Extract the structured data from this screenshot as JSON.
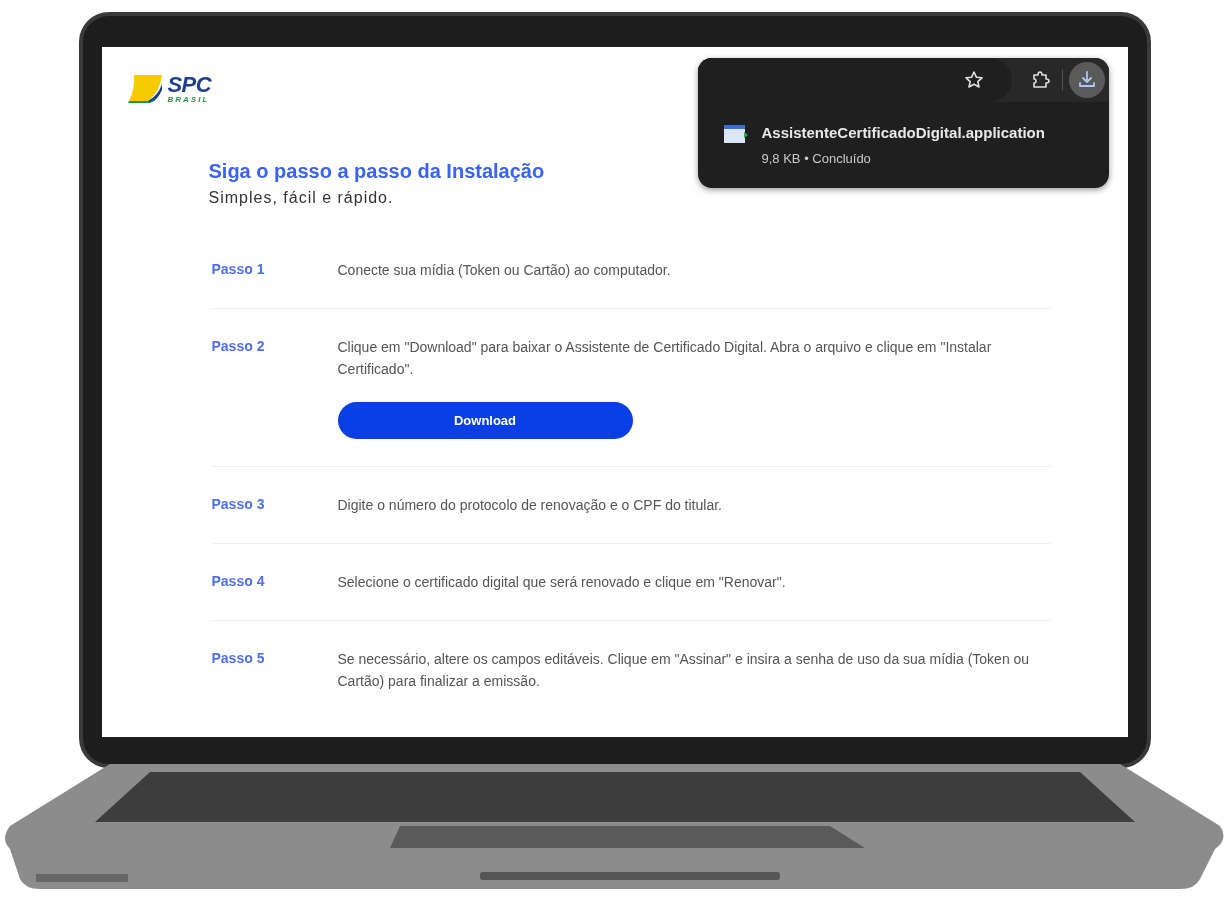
{
  "logo": {
    "name": "SPC",
    "tagline": "BRASIL"
  },
  "heading": "Siga o passo a passo da Instalação",
  "subtitle": "Simples, fácil e rápido.",
  "steps": [
    {
      "label": "Passo 1",
      "text": "Conecte sua mídia (Token ou Cartão) ao computador."
    },
    {
      "label": "Passo 2",
      "text": "Clique em \"Download\" para baixar o Assistente de Certificado Digital. Abra o arquivo e clique em \"Instalar Certificado\".",
      "button": "Download"
    },
    {
      "label": "Passo 3",
      "text": "Digite o número do protocolo de renovação e o CPF do titular."
    },
    {
      "label": "Passo 4",
      "text": "Selecione o certificado digital que será renovado e clique em \"Renovar\"."
    },
    {
      "label": "Passo 5",
      "text": "Se necessário, altere os campos editáveis. Clique em \"Assinar\" e insira a senha de uso da sua mídia (Token ou Cartão) para finalizar a emissão."
    }
  ],
  "toolbar": [
    {
      "kind": "star",
      "selected": false
    },
    {
      "kind": "extensions",
      "selected": false
    },
    {
      "kind": "downloads",
      "selected": true
    }
  ],
  "download": {
    "filename": "AssistenteCertificadoDigital.application",
    "detail": "9,8 KB • Concluído"
  }
}
